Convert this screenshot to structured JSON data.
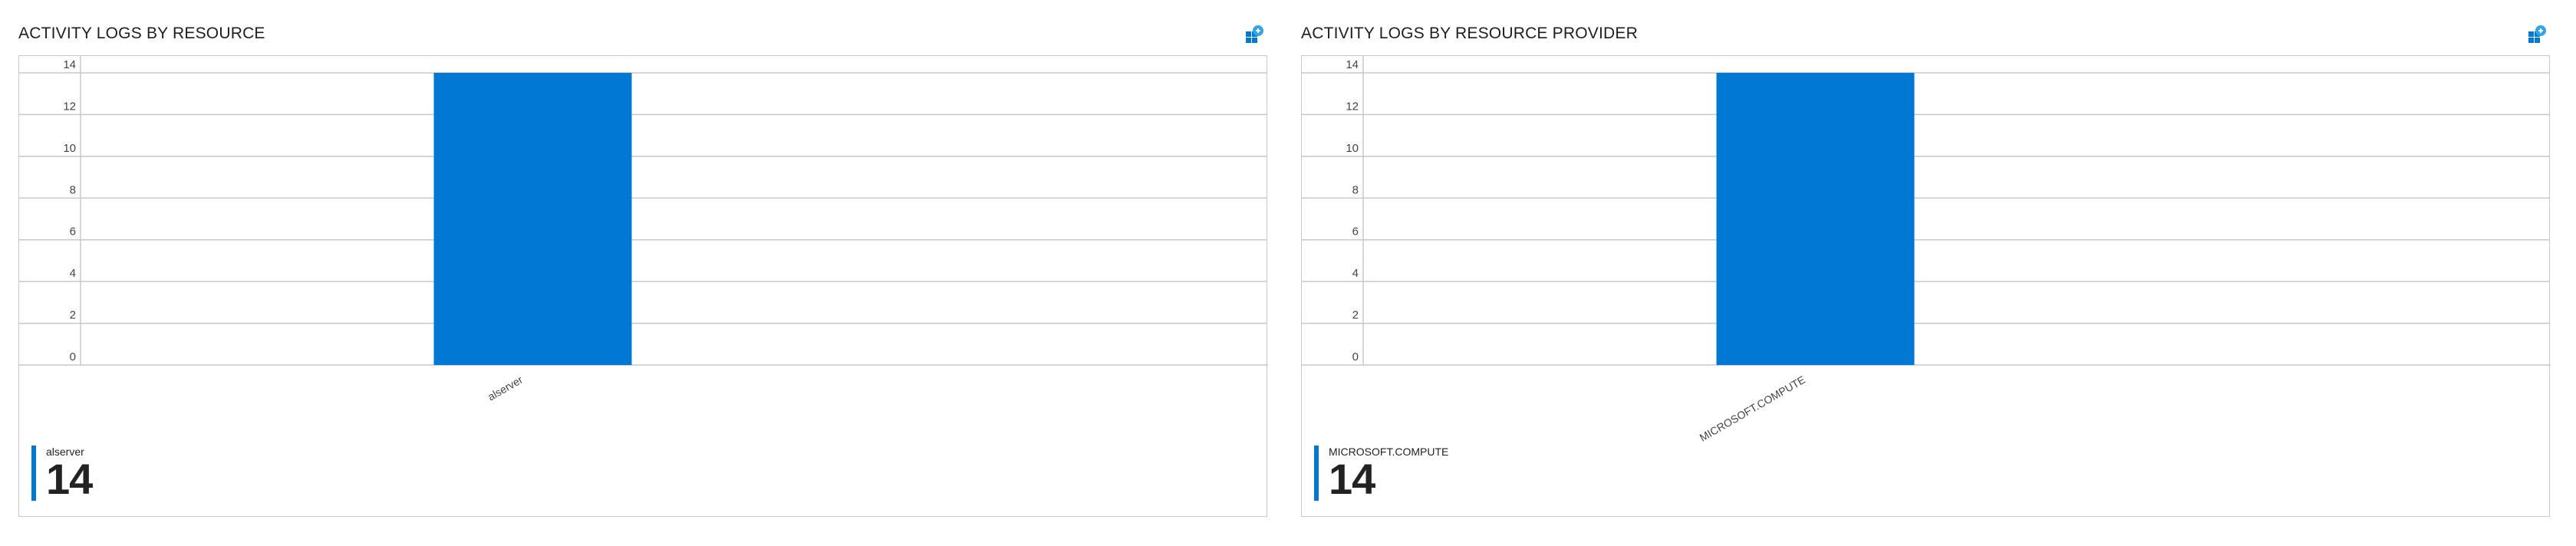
{
  "colors": {
    "bar": "#0078d4",
    "grid": "#c8c8c8",
    "pin_accent": "#0078d4"
  },
  "panels": [
    {
      "title": "ACTIVITY LOGS BY RESOURCE",
      "pin_icon": "pin-to-dashboard-icon",
      "legend": {
        "label": "alserver",
        "value": "14"
      }
    },
    {
      "title": "ACTIVITY LOGS BY RESOURCE PROVIDER",
      "pin_icon": "pin-to-dashboard-icon",
      "legend": {
        "label": "MICROSOFT.COMPUTE",
        "value": "14"
      }
    }
  ],
  "chart_data": [
    {
      "type": "bar",
      "title": "ACTIVITY LOGS BY RESOURCE",
      "categories": [
        "alserver"
      ],
      "values": [
        14
      ],
      "ylim": [
        0,
        14
      ],
      "yticks": [
        0,
        2,
        4,
        6,
        8,
        10,
        12,
        14
      ],
      "grid": true
    },
    {
      "type": "bar",
      "title": "ACTIVITY LOGS BY RESOURCE PROVIDER",
      "categories": [
        "MICROSOFT.COMPUTE"
      ],
      "values": [
        14
      ],
      "ylim": [
        0,
        14
      ],
      "yticks": [
        0,
        2,
        4,
        6,
        8,
        10,
        12,
        14
      ],
      "grid": true
    }
  ]
}
